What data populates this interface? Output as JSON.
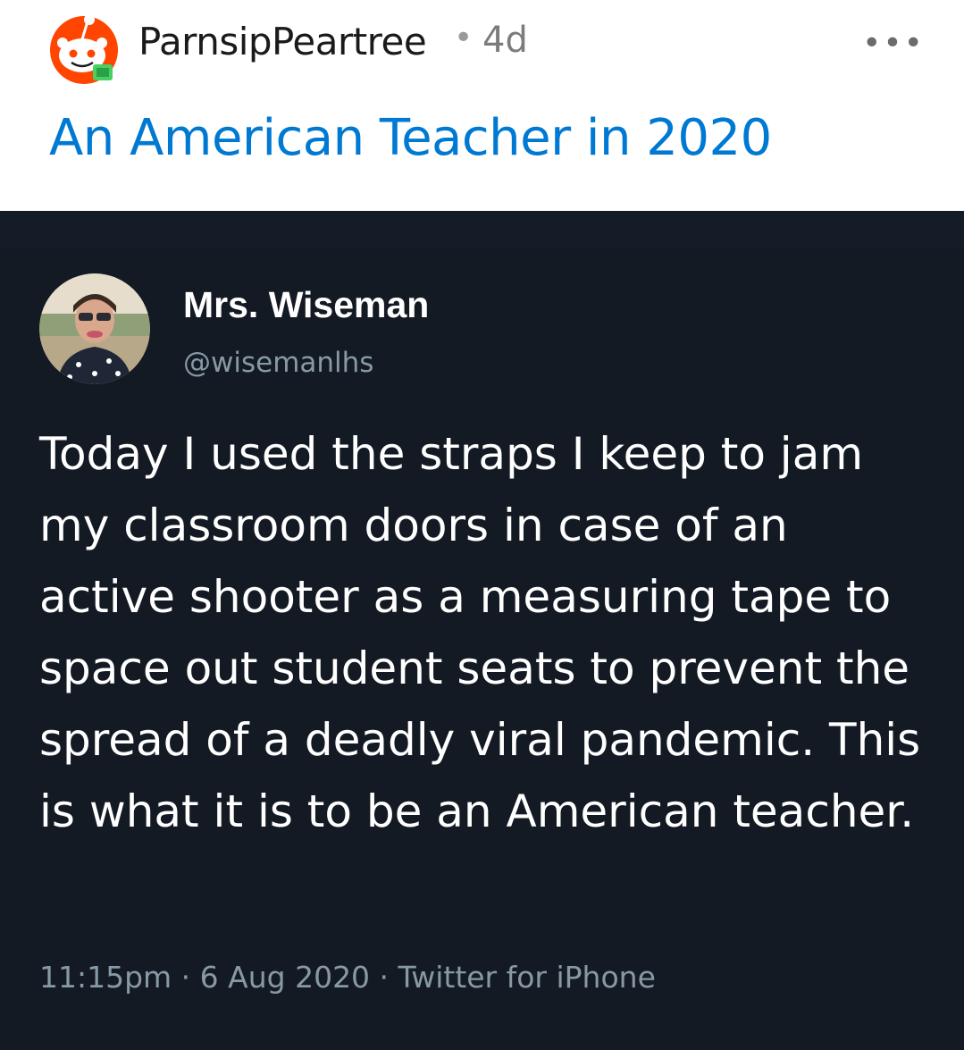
{
  "post": {
    "username": "ParnsipPeartree",
    "separator": "•",
    "age": "4d",
    "more_label": "•••",
    "title": "An American Teacher in 2020",
    "avatar_icon": "reddit-snoo-avatar-icon",
    "title_color": "#0079d3"
  },
  "tweet": {
    "display_name": "Mrs. Wiseman",
    "handle": "@wisemanlhs",
    "text": "Today I used the straps I keep to jam my classroom doors in case of an active shooter as a measuring tape to space out student seats to prevent the spread of a deadly viral pandemic. This is what it is to be an American teacher.",
    "meta": "11:15pm · 6 Aug 2020 · Twitter for iPhone",
    "background_color": "#131a23"
  }
}
